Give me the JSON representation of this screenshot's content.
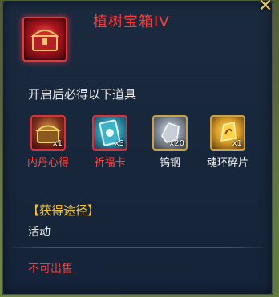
{
  "item": {
    "title": "植树宝箱IV",
    "icon": "treasure-chest-icon"
  },
  "guaranteed": {
    "label": "开启后必得以下道具",
    "rewards": [
      {
        "name": "内丹心得",
        "qty": "x1",
        "icon": "chest-icon",
        "rarity_color": "#d9323a"
      },
      {
        "name": "祈福卡",
        "qty": "x3",
        "icon": "card-icon",
        "rarity_color": "#d9323a"
      },
      {
        "name": "钨钢",
        "qty": "x20",
        "icon": "metal-ore-icon",
        "rarity_color": "#c9a24e"
      },
      {
        "name": "魂环碎片",
        "qty": "x1",
        "icon": "soul-ring-shard-icon",
        "rarity_color": "#c9a24e"
      }
    ]
  },
  "source": {
    "header": "【获得途径】",
    "value": "活动"
  },
  "footer": {
    "not_sellable": "不可出售"
  },
  "colors": {
    "title_red": "#ff3a3a",
    "header_gold": "#f0c23a",
    "panel_bg": "#1b2a3f"
  }
}
